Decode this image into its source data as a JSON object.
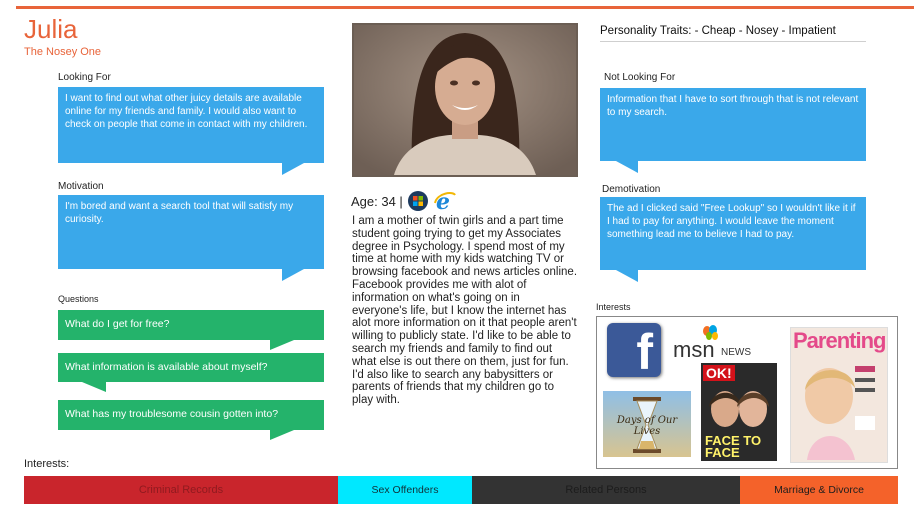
{
  "header": {
    "name": "Julia",
    "nickname": "The Nosey One",
    "accent_color": "#e8643a"
  },
  "looking_for": {
    "label": "Looking For",
    "text": "I want to find out what other juicy details are available online for my friends and family. I would also want to check on people that come in contact with my children."
  },
  "motivation": {
    "label": "Motivation",
    "text": "I'm bored and want a search tool that will satisfy my curiosity."
  },
  "questions": {
    "label": "Questions",
    "items": [
      "What do I get for free?",
      "What information is available about myself?",
      "What has my troublesome cousin gotten into?"
    ]
  },
  "profile": {
    "age_label": "Age: 34 |",
    "browser_icons": [
      "windows-logo-icon",
      "internet-explorer-icon"
    ],
    "bio": "I am a mother of twin girls and a part time student going trying to get my Associates degree in Psychology. I spend most of my time at home with my kids watching TV or browsing facebook and news articles online. Facebook provides me with alot of information on what's going on in everyone's life, but I know the internet has alot more information on it that people aren't willing to publicly state. I'd like to be able to search my friends and family to find out what else is out there on them, just for fun. I'd also like to search any babysitters or parents of friends that my children go to play with."
  },
  "traits": {
    "text": "Personality Traits: - Cheap - Nosey - Impatient"
  },
  "not_looking_for": {
    "label": "Not Looking For",
    "text": "Information that I have to sort through that is not relevant to my search."
  },
  "demotivation": {
    "label": "Demotivation",
    "text": "The ad I clicked  said \"Free Lookup\" so I wouldn't like it if I had to pay for anything.  I would leave the moment something lead me to believe I had to pay."
  },
  "interests_panel": {
    "label": "Interests",
    "logos": {
      "facebook": "f",
      "msn": "msn",
      "msn_news": "NEWS",
      "days_title": "Days of Our Lives",
      "ok": "OK!",
      "face_to_face": "FACE TO FACE",
      "parenting": "Parenting"
    }
  },
  "bottom": {
    "label": "Interests:",
    "segments": [
      {
        "label": "Criminal Records",
        "color": "#c9252c"
      },
      {
        "label": "Sex Offenders",
        "color": "#00e8ff"
      },
      {
        "label": "Related Persons",
        "color": "#333333"
      },
      {
        "label": "Marriage & Divorce",
        "color": "#f4622a"
      }
    ]
  }
}
